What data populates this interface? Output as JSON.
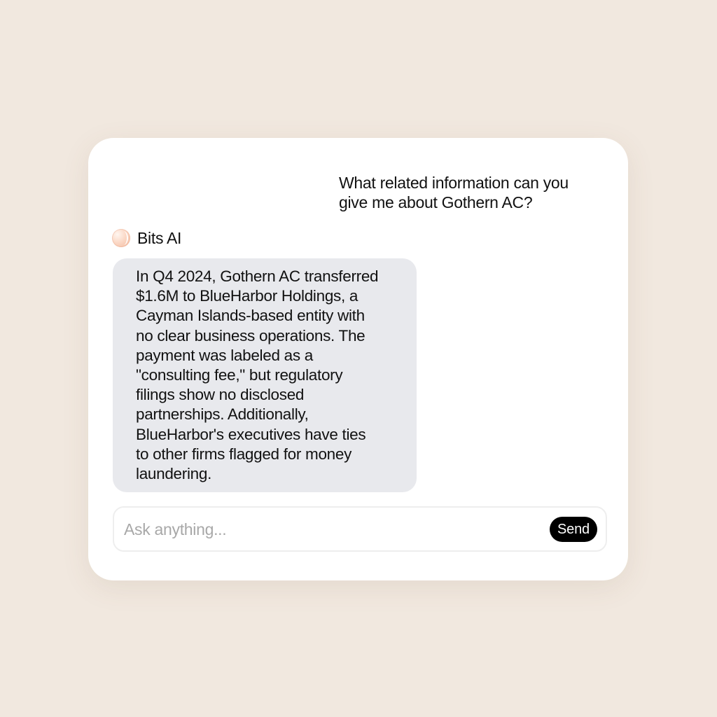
{
  "conversation": {
    "user_message": "What related information can you\ngive me about Gothern AC?",
    "assistant": {
      "name": "Bits AI",
      "avatar_icon": "bits-ai-avatar-icon",
      "message": "In Q4 2024, Gothern AC transferred\n$1.6M to BlueHarbor Holdings, a\nCayman Islands-based entity with\nno clear business operations. The\npayment was labeled as a\n\"consulting fee,\" but regulatory\nfilings show no disclosed\npartnerships. Additionally,\nBlueHarbor's executives have ties\nto other firms flagged for money\nlaundering."
    }
  },
  "composer": {
    "placeholder": "Ask anything...",
    "value": "",
    "send_label": "Send"
  },
  "colors": {
    "background": "#f1e8df",
    "card": "#ffffff",
    "assistant_bubble": "#e8e9ed",
    "send_button": "#000000"
  }
}
